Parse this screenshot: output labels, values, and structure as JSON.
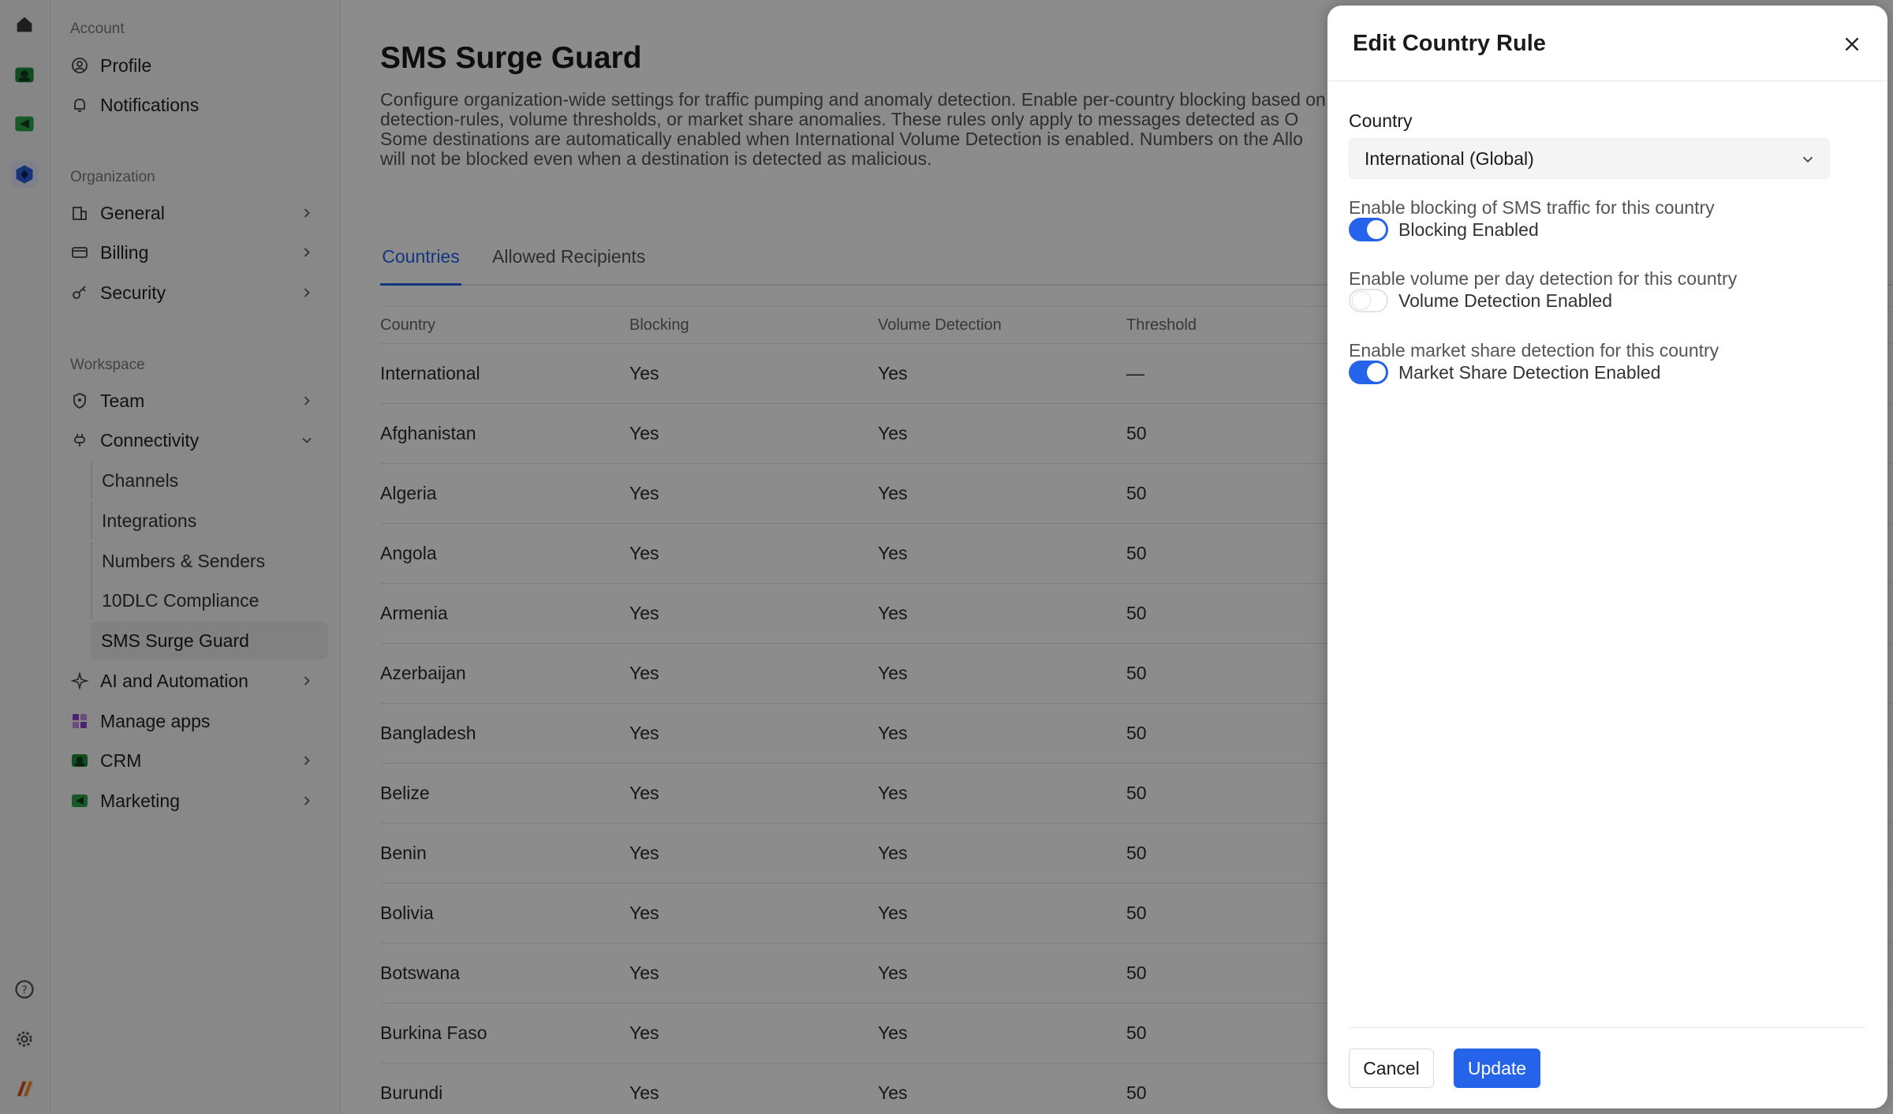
{
  "rail": {
    "top_icons": [
      "home-icon",
      "crm-app-icon",
      "marketing-app-icon",
      "workspace-logo-icon"
    ],
    "bottom_icons": [
      "help-icon",
      "settings-icon",
      "brand-logo-icon"
    ]
  },
  "sidebar": {
    "account_title": "Account",
    "account_items": [
      {
        "label": "Profile",
        "icon": "user-circle-icon"
      },
      {
        "label": "Notifications",
        "icon": "bell-icon"
      }
    ],
    "organization_title": "Organization",
    "organization_items": [
      {
        "label": "General",
        "icon": "building-icon"
      },
      {
        "label": "Billing",
        "icon": "credit-card-icon"
      },
      {
        "label": "Security",
        "icon": "key-icon"
      }
    ],
    "workspace_title": "Workspace",
    "workspace_items": [
      {
        "label": "Team",
        "icon": "shield-icon"
      },
      {
        "label": "Connectivity",
        "icon": "plug-icon"
      }
    ],
    "connectivity_sub": [
      "Channels",
      "Integrations",
      "Numbers & Senders",
      "10DLC Compliance",
      "SMS Surge Guard"
    ],
    "more_items": [
      {
        "label": "AI and Automation",
        "icon": "sparkle-icon"
      },
      {
        "label": "Manage apps",
        "icon": "apps-icon"
      },
      {
        "label": "CRM",
        "icon": "crm-icon"
      },
      {
        "label": "Marketing",
        "icon": "marketing-icon"
      }
    ]
  },
  "main": {
    "title": "SMS Surge Guard",
    "description": [
      "Configure organization-wide settings for traffic pumping and anomaly detection. Enable per-country blocking based on",
      "detection-rules, volume thresholds, or market share anomalies. These rules only apply to messages detected as O",
      "Some destinations are automatically enabled when International Volume Detection is enabled. Numbers on the Allo",
      "will not be blocked even when a destination is detected as malicious."
    ],
    "tabs": [
      "Countries",
      "Allowed Recipients"
    ],
    "table": {
      "headers": [
        "Country",
        "Blocking",
        "Volume Detection",
        "Threshold"
      ],
      "rows": [
        [
          "International",
          "Yes",
          "Yes",
          "—"
        ],
        [
          "Afghanistan",
          "Yes",
          "Yes",
          "50"
        ],
        [
          "Algeria",
          "Yes",
          "Yes",
          "50"
        ],
        [
          "Angola",
          "Yes",
          "Yes",
          "50"
        ],
        [
          "Armenia",
          "Yes",
          "Yes",
          "50"
        ],
        [
          "Azerbaijan",
          "Yes",
          "Yes",
          "50"
        ],
        [
          "Bangladesh",
          "Yes",
          "Yes",
          "50"
        ],
        [
          "Belize",
          "Yes",
          "Yes",
          "50"
        ],
        [
          "Benin",
          "Yes",
          "Yes",
          "50"
        ],
        [
          "Bolivia",
          "Yes",
          "Yes",
          "50"
        ],
        [
          "Botswana",
          "Yes",
          "Yes",
          "50"
        ],
        [
          "Burkina Faso",
          "Yes",
          "Yes",
          "50"
        ],
        [
          "Burundi",
          "Yes",
          "Yes",
          "50"
        ]
      ]
    }
  },
  "drawer": {
    "title": "Edit Country Rule",
    "country_label": "Country",
    "country_value": "International (Global)",
    "options": [
      {
        "description": "Enable blocking of SMS traffic for this country",
        "toggle_label": "Blocking Enabled",
        "enabled": true
      },
      {
        "description": "Enable volume per day detection for this country",
        "toggle_label": "Volume Detection Enabled",
        "enabled": false
      },
      {
        "description": "Enable market share detection for this country",
        "toggle_label": "Market Share Detection Enabled",
        "enabled": true
      }
    ],
    "cancel_label": "Cancel",
    "update_label": "Update"
  },
  "colors": {
    "accent": "#2563eb",
    "overlay": "rgba(0,0,0,0.45)"
  }
}
